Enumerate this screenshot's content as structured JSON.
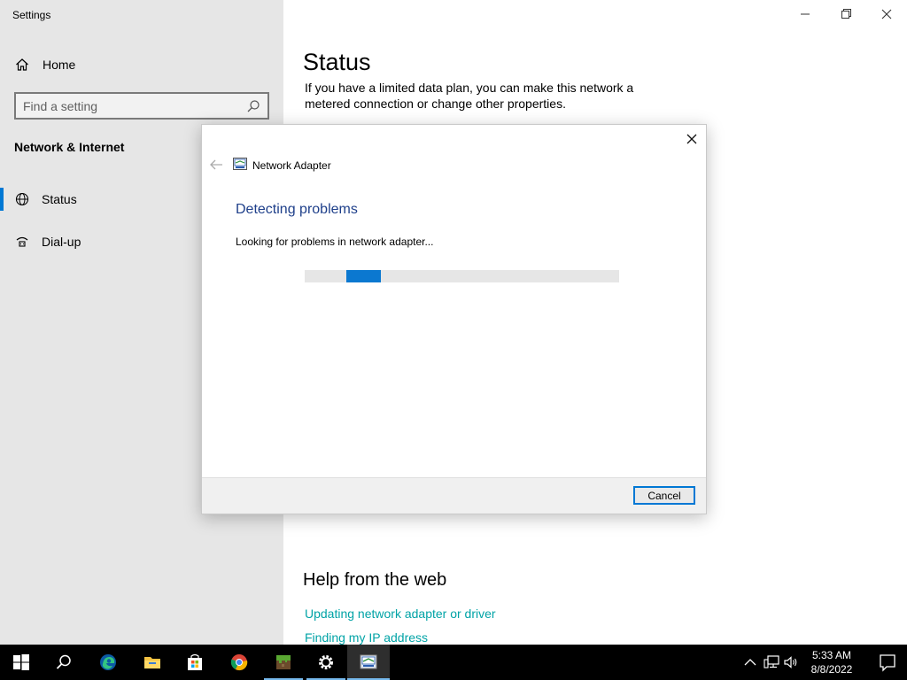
{
  "window": {
    "app_title": "Settings",
    "controls": [
      "minimize-icon",
      "restore-icon",
      "close-icon"
    ]
  },
  "sidebar": {
    "home_label": "Home",
    "search_placeholder": "Find a setting",
    "section_title": "Network & Internet",
    "items": [
      {
        "label": "Status",
        "icon": "globe-icon",
        "active": true
      },
      {
        "label": "Dial-up",
        "icon": "dialup-icon",
        "active": false
      }
    ]
  },
  "main": {
    "title": "Status",
    "description": "If you have a limited data plan, you can make this network a metered connection or change other properties.",
    "help_title": "Help from the web",
    "help_links": [
      "Updating network adapter or driver",
      "Finding my IP address"
    ]
  },
  "dialog": {
    "app_title": "Network Adapter",
    "heading": "Detecting problems",
    "status_text": "Looking for problems in network adapter...",
    "cancel_label": "Cancel",
    "progress_state": "indeterminate"
  },
  "taskbar": {
    "apps": [
      "start-icon",
      "search-icon",
      "edge-icon",
      "file-explorer-icon",
      "store-icon",
      "chrome-icon",
      "minecraft-icon",
      "settings-icon",
      "troubleshooter-icon"
    ],
    "time": "5:33 AM",
    "date": "8/8/2022"
  },
  "colors": {
    "accent": "#0078d4",
    "link": "#00a3a6",
    "heading_blue": "#1e3f8a",
    "sidebar_bg": "#e6e6e6"
  }
}
